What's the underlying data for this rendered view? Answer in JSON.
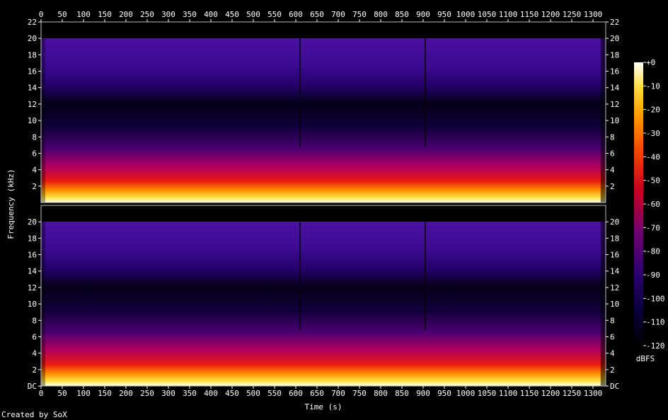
{
  "chart_data": {
    "type": "heatmap",
    "xlabel": "Time (s)",
    "ylabel": "Frequency (kHz)",
    "xlim": [
      0,
      1330
    ],
    "ylim": [
      0,
      22
    ],
    "x_ticks": [
      "0",
      "50",
      "100",
      "150",
      "200",
      "250",
      "300",
      "350",
      "400",
      "450",
      "500",
      "550",
      "600",
      "650",
      "700",
      "750",
      "800",
      "850",
      "900",
      "950",
      "1000",
      "1050",
      "1100",
      "1150",
      "1200",
      "1250",
      "1300"
    ],
    "y_ticks_top": [
      "2",
      "4",
      "6",
      "8",
      "10",
      "12",
      "14",
      "16",
      "18",
      "20",
      "22"
    ],
    "y_ticks_bottom": [
      "DC",
      "2",
      "4",
      "6",
      "8",
      "10",
      "12",
      "14",
      "16",
      "18",
      "20"
    ],
    "colorbar": {
      "label": "dBFS",
      "ticks": [
        "+0",
        "-10",
        "-20",
        "-30",
        "-40",
        "-50",
        "-60",
        "-70",
        "-80",
        "-90",
        "-100",
        "-110",
        "-120"
      ],
      "range": [
        -120,
        0
      ]
    },
    "channels": 2,
    "content_cutoff_khz": 20,
    "track_boundaries_s": [
      610,
      905
    ],
    "credit": "Created by SoX"
  }
}
